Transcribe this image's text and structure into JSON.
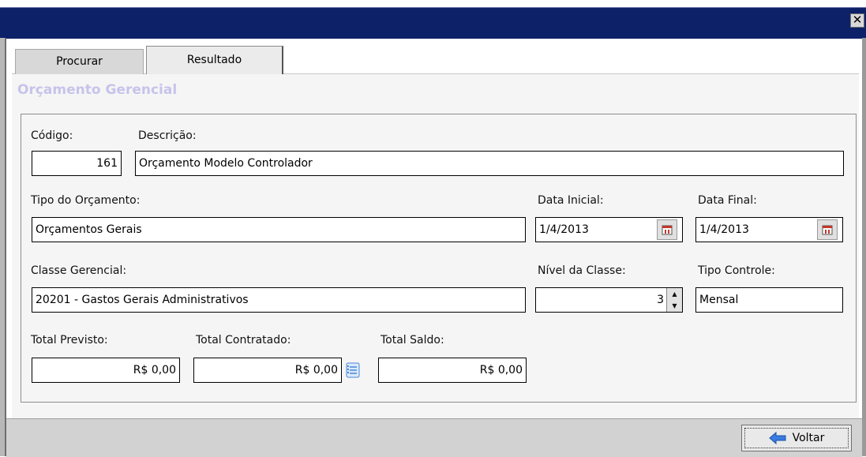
{
  "window": {
    "close_glyph": "✕"
  },
  "tabs": [
    {
      "label": "Procurar",
      "active": false
    },
    {
      "label": "Resultado",
      "active": true
    }
  ],
  "form": {
    "title": "Orçamento Gerencial",
    "codigo": {
      "label": "Código:",
      "value": "161"
    },
    "descricao": {
      "label": "Descrição:",
      "value": "Orçamento Modelo Controlador"
    },
    "tipo_orcamento": {
      "label": "Tipo do Orçamento:",
      "value": "Orçamentos Gerais"
    },
    "data_inicial": {
      "label": "Data Inicial:",
      "value": "1/4/2013"
    },
    "data_final": {
      "label": "Data Final:",
      "value": "1/4/2013"
    },
    "classe_gerencial": {
      "label": "Classe Gerencial:",
      "value": "20201 - Gastos Gerais Administrativos"
    },
    "nivel_classe": {
      "label": "Nível da Classe:",
      "value": "3"
    },
    "tipo_controle": {
      "label": "Tipo Controle:",
      "value": "Mensal"
    },
    "total_previsto": {
      "label": "Total Previsto:",
      "value": "R$ 0,00"
    },
    "total_contratado": {
      "label": "Total Contratado:",
      "value": "R$ 0,00"
    },
    "total_saldo": {
      "label": "Total Saldo:",
      "value": "R$ 0,00"
    }
  },
  "footer": {
    "voltar_label": "Voltar"
  },
  "colors": {
    "titlebar": "#0c2168",
    "form_title": "#c7c3eb",
    "accent_blue": "#2f6fd6"
  },
  "icons": [
    "close-icon",
    "calendar-icon",
    "spin-up-icon",
    "spin-down-icon",
    "document-list-icon",
    "back-arrow-icon"
  ]
}
